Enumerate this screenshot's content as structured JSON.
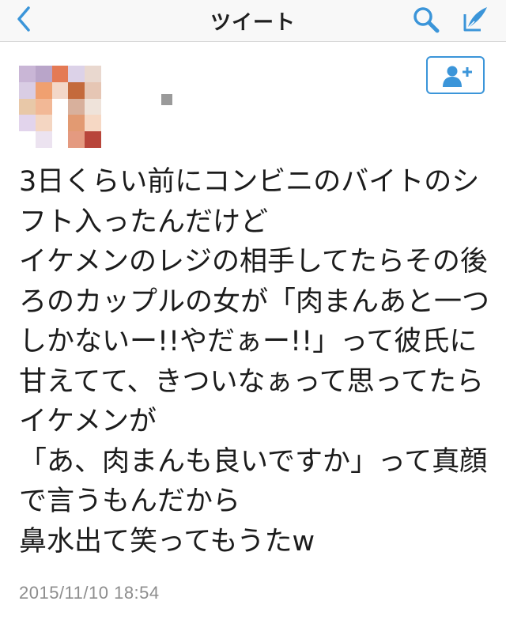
{
  "nav": {
    "title": "ツイート",
    "back_icon": "chevron-left-icon",
    "search_icon": "search-icon",
    "compose_icon": "compose-tweet-icon",
    "accent_color": "#3b95d9"
  },
  "tweet": {
    "avatar_icon": "avatar",
    "follow_icon": "add-user-icon",
    "text": "3日くらい前にコンビニのバイトのシフト入ったんだけど\nイケメンのレジの相手してたらその後ろのカップルの女が「肉まんあと一つしかないー!!やだぁー!!」って彼氏に甘えてて、きついなぁって思ってたらイケメンが\n「あ、肉まんも良いですか」って真顔で言うもんだから\n鼻水出て笑ってもうたw",
    "timestamp": "2015/11/10 18:54"
  }
}
